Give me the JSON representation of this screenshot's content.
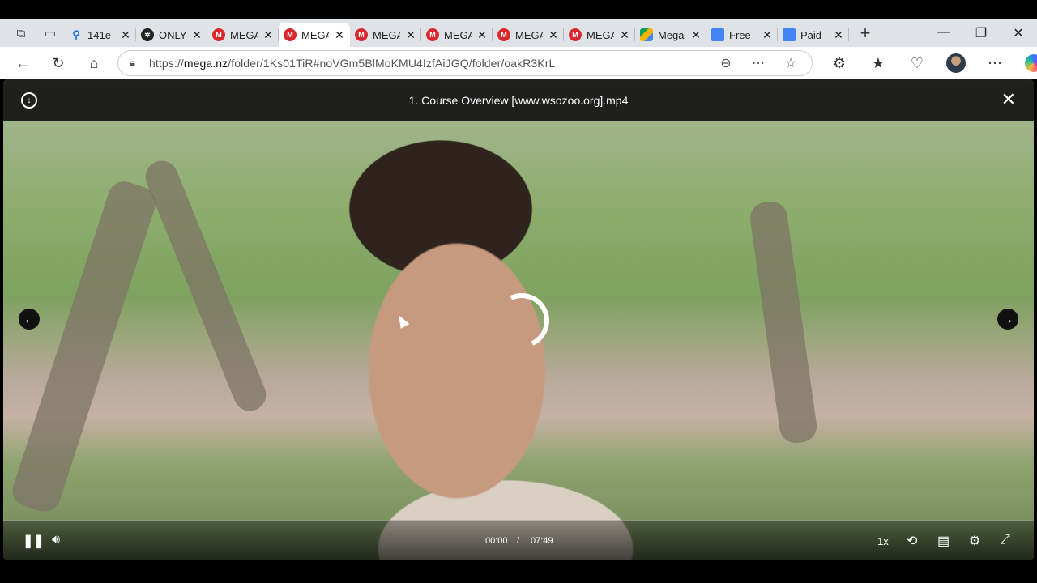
{
  "tabs": [
    {
      "title": "141e",
      "favicon": "search",
      "active": false
    },
    {
      "title": "ONLY",
      "favicon": "only",
      "active": false
    },
    {
      "title": "MEGA",
      "favicon": "mega",
      "active": false
    },
    {
      "title": "MEGA",
      "favicon": "mega",
      "active": true
    },
    {
      "title": "MEGA",
      "favicon": "mega",
      "active": false
    },
    {
      "title": "MEGA",
      "favicon": "mega",
      "active": false
    },
    {
      "title": "MEGA",
      "favicon": "mega",
      "active": false
    },
    {
      "title": "MEGA",
      "favicon": "mega",
      "active": false
    },
    {
      "title": "Mega",
      "favicon": "drive",
      "active": false
    },
    {
      "title": "Free",
      "favicon": "doc",
      "active": false
    },
    {
      "title": "Paid",
      "favicon": "doc",
      "active": false
    }
  ],
  "address": {
    "prefix": "https://",
    "domain": "mega.nz",
    "path": "/folder/1Ks01TiR#noVGm5BlMoKMU4IzfAiJGQ/folder/oakR3KrL"
  },
  "viewer": {
    "title": "1. Course Overview [www.wsozoo.org].mp4",
    "current_time": "00:00",
    "separator": "/",
    "duration": "07:49",
    "speed": "1x",
    "progress": 0
  },
  "colors": {
    "mega_red": "#d9272e",
    "viewer_header": "#141414"
  }
}
